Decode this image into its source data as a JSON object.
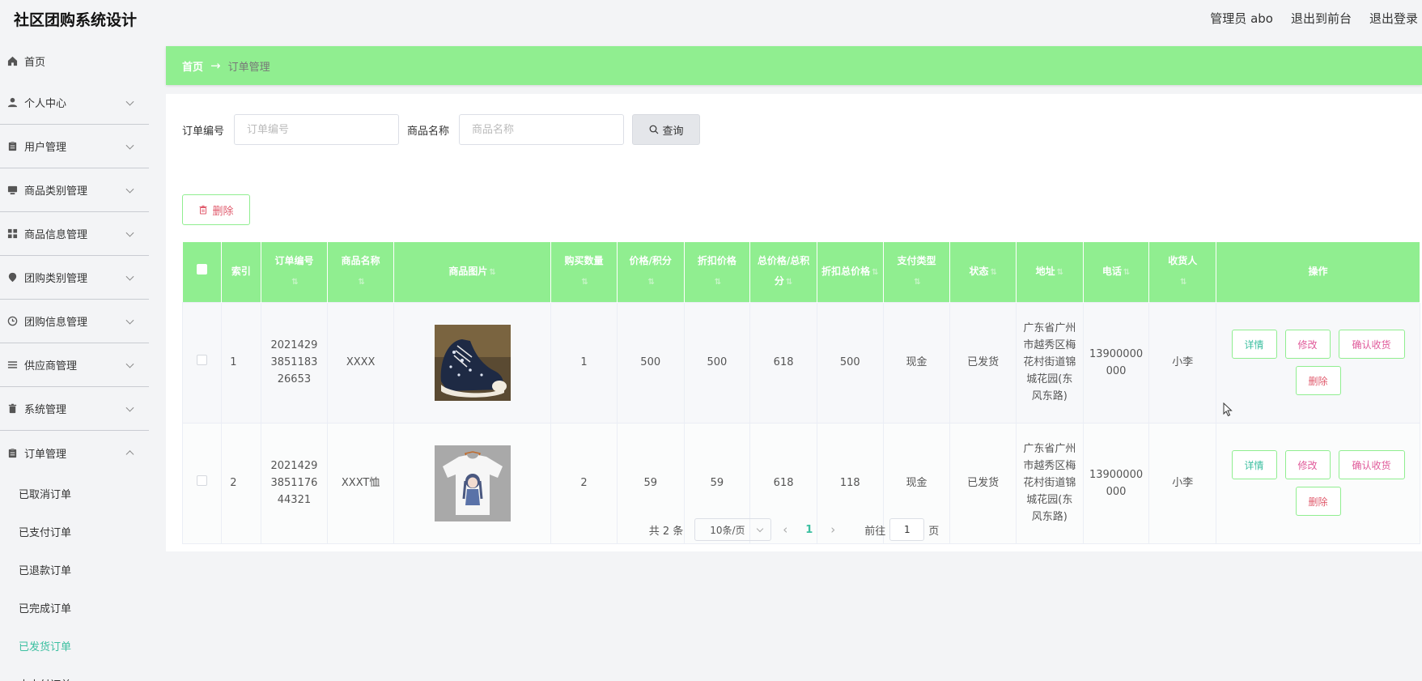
{
  "app": {
    "title": "社区团购系统设计"
  },
  "topnav": {
    "user": "管理员 abo",
    "to_front": "退出到前台",
    "logout": "退出登录"
  },
  "sidebar": {
    "items": [
      {
        "label": "首页",
        "icon": "home-icon"
      },
      {
        "label": "个人中心",
        "icon": "user-icon"
      },
      {
        "label": "用户管理",
        "icon": "clipboard-icon"
      },
      {
        "label": "商品类别管理",
        "icon": "monitor-icon"
      },
      {
        "label": "商品信息管理",
        "icon": "grid-icon"
      },
      {
        "label": "团购类别管理",
        "icon": "location-icon"
      },
      {
        "label": "团购信息管理",
        "icon": "clock-icon"
      },
      {
        "label": "供应商管理",
        "icon": "list-icon"
      },
      {
        "label": "系统管理",
        "icon": "trash-icon"
      },
      {
        "label": "订单管理",
        "icon": "clipboard-icon"
      }
    ],
    "submenu": [
      "已取消订单",
      "已支付订单",
      "已退款订单",
      "已完成订单",
      "已发货订单",
      "未支付订单"
    ],
    "active_submenu": "已发货订单"
  },
  "breadcrumb": {
    "home": "首页",
    "arrow": "→",
    "current": "订单管理"
  },
  "search": {
    "order_label": "订单编号",
    "order_placeholder": "订单编号",
    "goods_label": "商品名称",
    "goods_placeholder": "商品名称",
    "query_button": "查询"
  },
  "batch_delete": "删除",
  "table": {
    "headers": [
      "",
      "索引",
      "订单编号",
      "商品名称",
      "商品图片",
      "购买数量",
      "价格/积分",
      "折扣价格",
      "总价格/总积分",
      "折扣总价格",
      "支付类型",
      "状态",
      "地址",
      "电话",
      "收货人",
      "操作"
    ],
    "rows": [
      {
        "index": "1",
        "order_no": "202142938511832 6653",
        "order_no_display": "2021429\n3851183\n26653",
        "goods": "XXXX",
        "image": "sneaker-photo",
        "qty": "1",
        "price": "500",
        "discount_price": "500",
        "total": "618",
        "discount_total": "500",
        "pay": "现金",
        "status": "已发货",
        "address": "广东省广州市越秀区梅花村街道锦城花园(东风东路)",
        "phone": "13900000000",
        "receiver": "小李"
      },
      {
        "index": "2",
        "order_no": "202142938511764 4321",
        "order_no_display": "2021429\n3851176\n44321",
        "goods": "XXXT恤",
        "image": "tshirt-photo",
        "qty": "2",
        "price": "59",
        "discount_price": "59",
        "total": "618",
        "discount_total": "118",
        "pay": "现金",
        "status": "已发货",
        "address": "广东省广州市越秀区梅花村街道锦城花园(东风东路)",
        "phone": "13900000000",
        "receiver": "小李"
      }
    ],
    "ops": {
      "detail": "详情",
      "edit": "修改",
      "confirm": "确认收货",
      "delete": "删除"
    }
  },
  "pager": {
    "total": "共 2 条",
    "page_size": "10条/页",
    "current": "1",
    "goto_label": "前往",
    "goto_value": "1",
    "unit": "页"
  },
  "colors": {
    "accent": "#90ee90",
    "link": "#3bbfa0",
    "danger": "#e05a6c"
  }
}
